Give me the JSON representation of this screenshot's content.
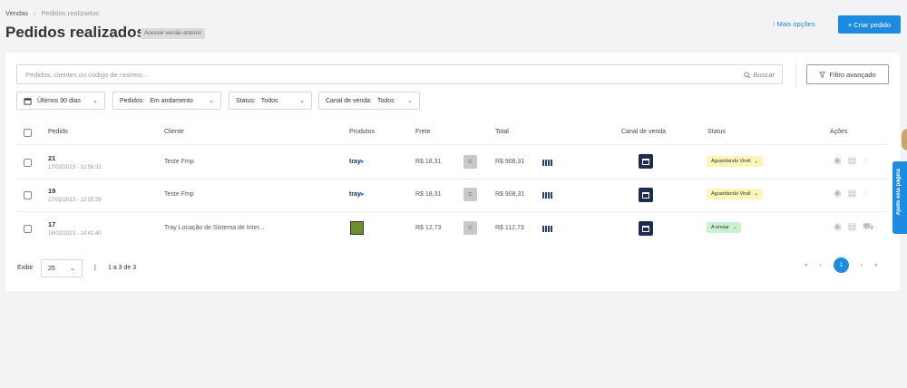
{
  "breadcrumb": {
    "parent": "Vendas",
    "sep": "›",
    "current": "Pedidos realizados"
  },
  "page": {
    "title": "Pedidos realizados",
    "legacy_button": "Acessar versão anterior",
    "more_options": "⁝ Mais opções",
    "create_button": "+ Criar pedido"
  },
  "search": {
    "placeholder": "Pedidos, clientes ou código de rastreio...",
    "button": "Buscar"
  },
  "filter_button": "Filtro avançado",
  "filters": {
    "period": "Últimos 90 dias",
    "orders_label": "Pedidos:",
    "orders_value": "Em andamento",
    "status_label": "Status:",
    "status_value": "Todos",
    "channel_label": "Canal de venda:",
    "channel_value": "Todos"
  },
  "table": {
    "headers": {
      "order": "Pedido",
      "client": "Cliente",
      "products": "Produtos",
      "freight": "Frete",
      "total": "Total",
      "channel": "Canal de venda",
      "status": "Status",
      "actions": "Ações"
    },
    "rows": [
      {
        "id": "21",
        "date": "17/02/2023 - 12:56:32",
        "client": "Teste Fmp",
        "product": "tray",
        "freight": "R$ 18,31",
        "badge": "C",
        "total": "R$ 908,31",
        "status": "Aguardando Vindi"
      },
      {
        "id": "19",
        "date": "17/02/2023 - 12:55:29",
        "client": "Teste Fmp",
        "product": "tray",
        "freight": "R$ 18,31",
        "badge": "C",
        "total": "R$ 908,31",
        "status": "Aguardando Vindi"
      },
      {
        "id": "17",
        "date": "16/02/2023 - 14:41:40",
        "client": "Tray Locação de Sistema de Inter...",
        "product": "",
        "freight": "R$ 12,73",
        "badge": "C",
        "total": "R$ 112,73",
        "status": "A enviar"
      }
    ]
  },
  "footer": {
    "show_label": "Exibir",
    "page_size": "25",
    "range": "1 a 3 de 3"
  },
  "pagination": {
    "first": "«",
    "prev": "‹",
    "current": "1",
    "next": "›",
    "last": "»"
  },
  "side_tab": "Ajude esta página",
  "colors": {
    "primary": "#1d8ce0",
    "status_waiting": "#fbf6b7",
    "status_send": "#c8f2cf",
    "channel": "#1e2d4f"
  }
}
